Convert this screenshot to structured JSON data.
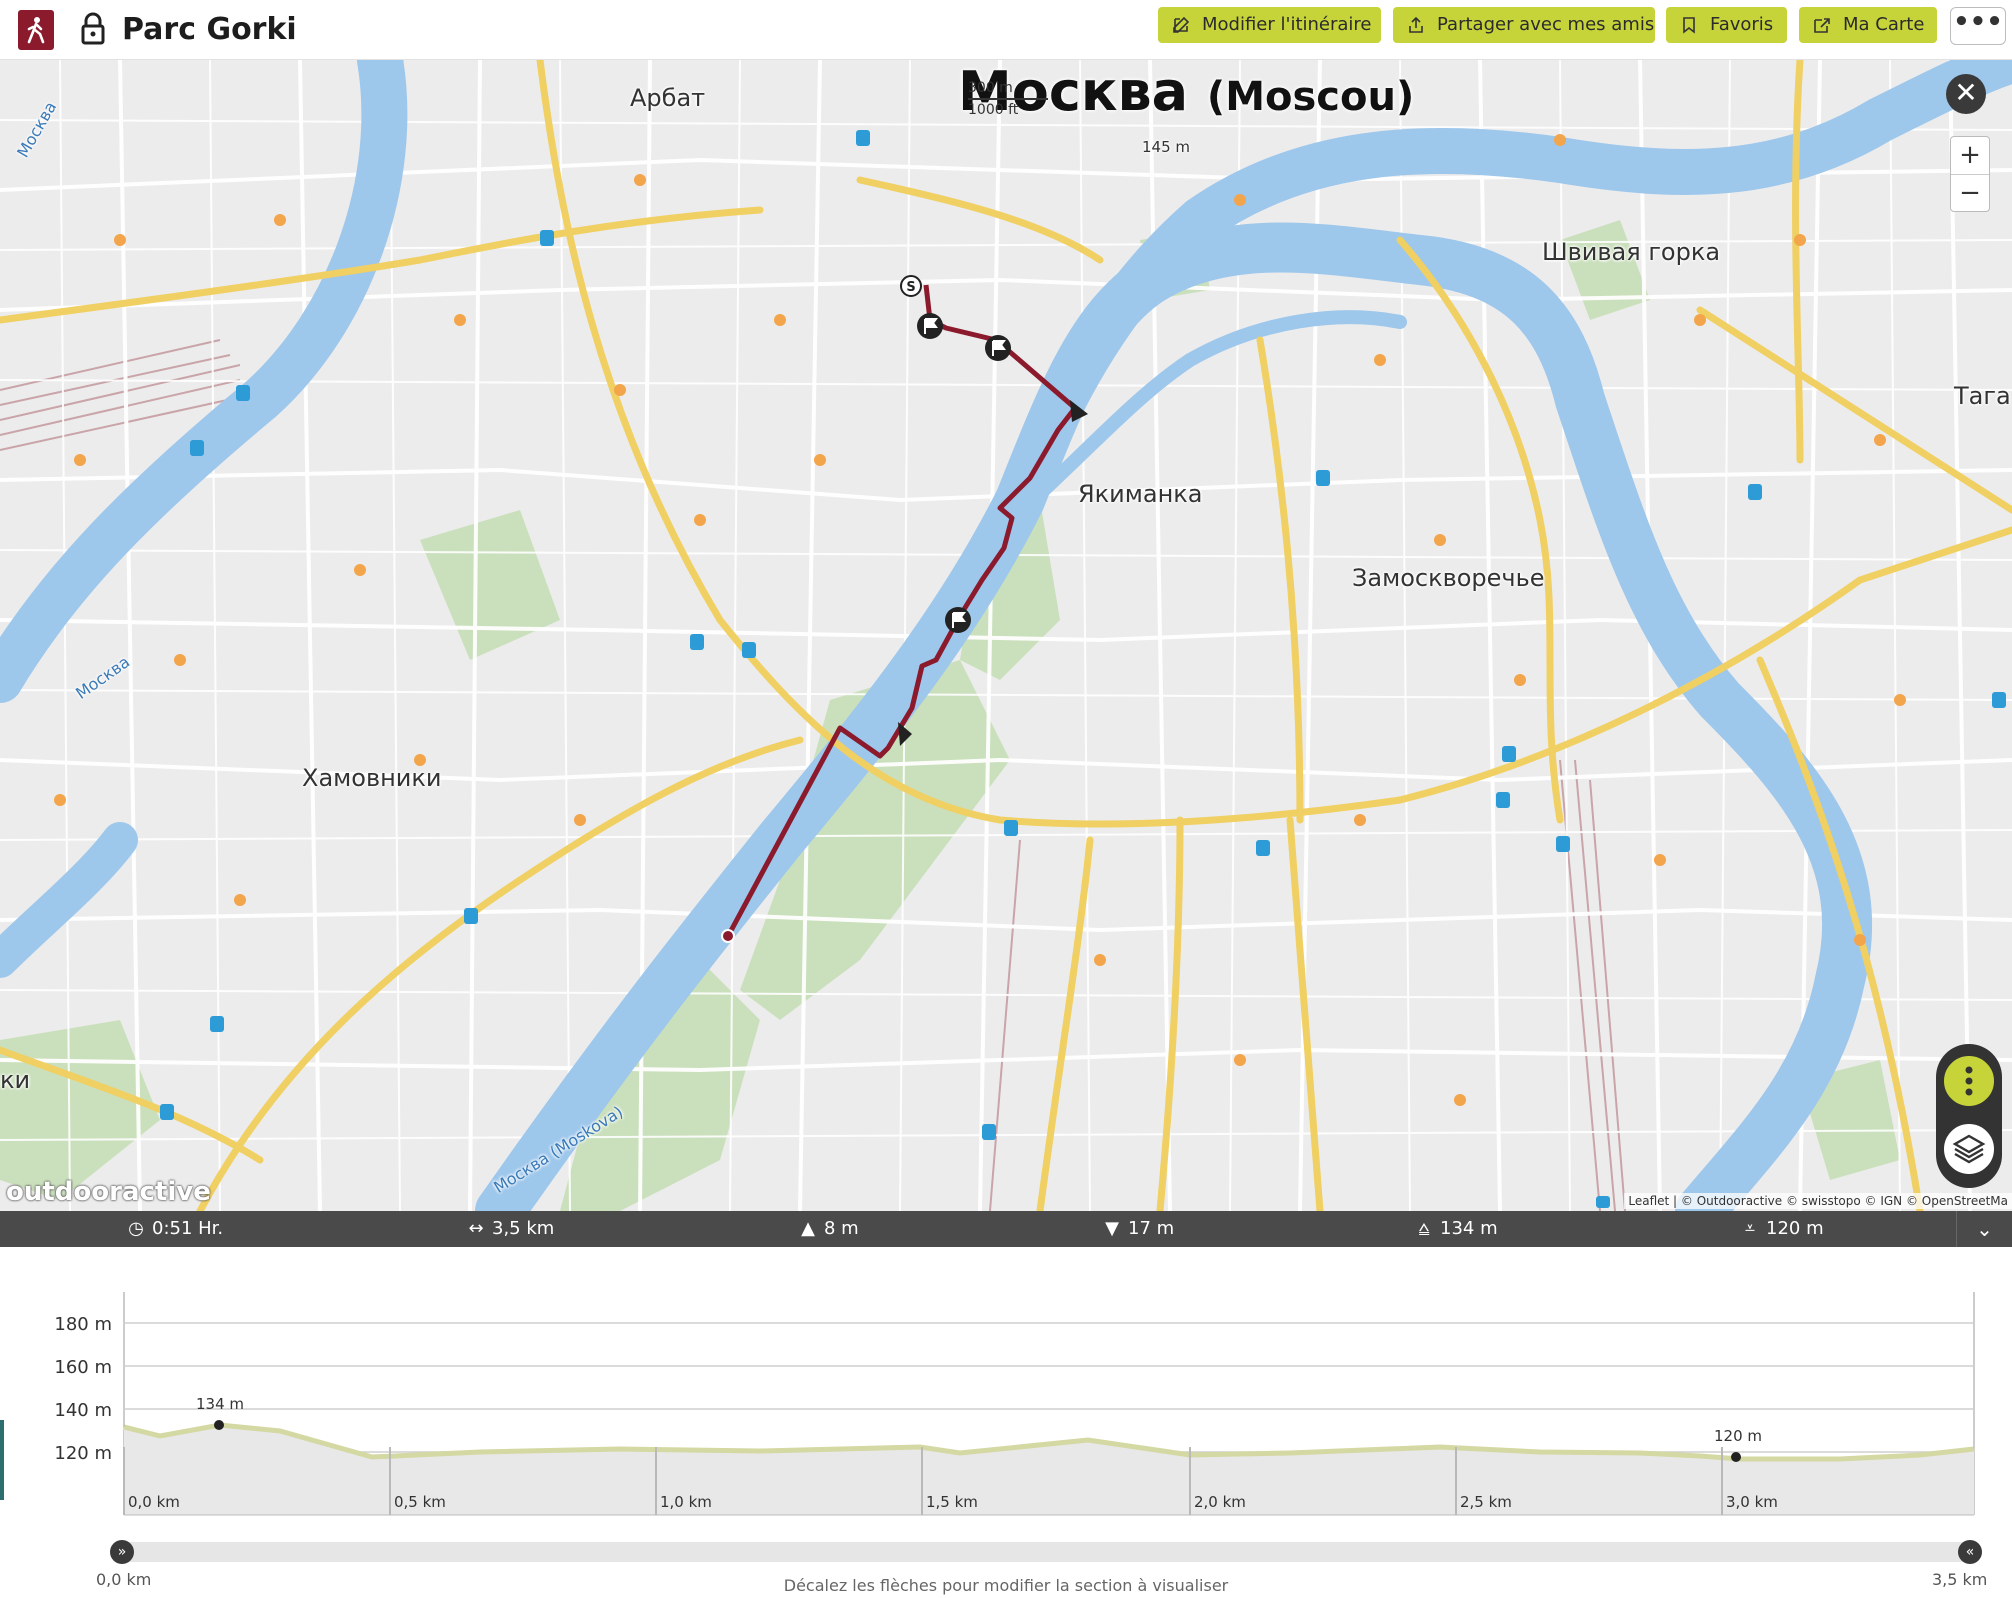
{
  "header": {
    "title": "Parc Gorki",
    "buttons": [
      {
        "label": "Modifier l'itinéraire"
      },
      {
        "label": "Partager avec mes amis"
      },
      {
        "label": "Favoris"
      },
      {
        "label": "Ma Carte"
      }
    ],
    "more_label": "•••",
    "accent": "#c6d43a",
    "brand": "#8a1a2c"
  },
  "map": {
    "city": "Москва",
    "city_sub": "(Moscou)",
    "scale": {
      "top": "300 m",
      "bottom": "1000 ft"
    },
    "elevation_marker": "145 m",
    "labels": [
      "Арбат",
      "Швивая горка",
      "Тага",
      "Якиманка",
      "Замоскворечье",
      "Хамовники",
      "Москва",
      "Москва",
      "Москва (Moskova)",
      "ки"
    ],
    "close": "✕",
    "zoom_in": "+",
    "zoom_out": "−",
    "start_marker": "S",
    "logo": "outdooractive",
    "attribution": "Leaflet | © Outdooractive © swisstopo © IGN © OpenStreetMa"
  },
  "stats": {
    "duration": "0:51 Hr.",
    "distance": "3,5 km",
    "ascent": "8 m",
    "descent": "17 m",
    "max_alt": "134 m",
    "min_alt": "120 m"
  },
  "profile": {
    "y_ticks": [
      "180 m",
      "160 m",
      "140 m",
      "120 m"
    ],
    "x_ticks": [
      "0,0 km",
      "0,5 km",
      "1,0 km",
      "1,5 km",
      "2,0 km",
      "2,5 km",
      "3,0 km"
    ],
    "max_label": "134 m",
    "min_label": "120 m",
    "slider_start": "0,0 km",
    "slider_end": "3,5 km",
    "hint": "Décalez les flèches pour modifier la section à visualiser"
  }
}
